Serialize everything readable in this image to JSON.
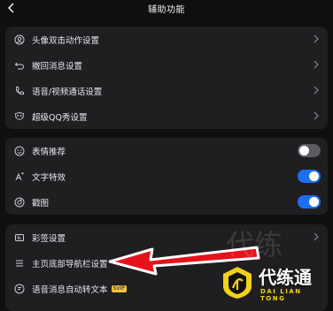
{
  "header": {
    "title": "辅助功能",
    "back_icon": "chevron-left-icon"
  },
  "group1": {
    "items": [
      {
        "label": "头像双击动作设置",
        "icon": "person-icon"
      },
      {
        "label": "撤回消息设置",
        "icon": "undo-icon"
      },
      {
        "label": "语音/视频通话设置",
        "icon": "phone-icon"
      },
      {
        "label": "超级QQ秀设置",
        "icon": "mask-icon"
      }
    ]
  },
  "group2": {
    "items": [
      {
        "label": "表情推荐",
        "icon": "smiley-icon",
        "toggle": false
      },
      {
        "label": "文字特效",
        "icon": "sparkle-text-icon",
        "toggle": true
      },
      {
        "label": "戳图",
        "icon": "poke-icon",
        "toggle": true
      }
    ]
  },
  "group3": {
    "items": [
      {
        "label": "彩签设置",
        "icon": "tag-icon"
      },
      {
        "label": "主页底部导航栏设置",
        "icon": "menu-icon"
      },
      {
        "label": "语音消息自动转文本",
        "icon": "speech-icon",
        "badge": "SVIP"
      }
    ]
  },
  "watermark": {
    "faint_text": "代练",
    "brand_name": "代练通",
    "brand_sub": "DAI LIAN TONG"
  },
  "colors": {
    "accent": "#1d6ff2",
    "arrow": "#e5121b",
    "brand_yellow": "#f1d21a",
    "card_bg": "#1f1f22"
  }
}
